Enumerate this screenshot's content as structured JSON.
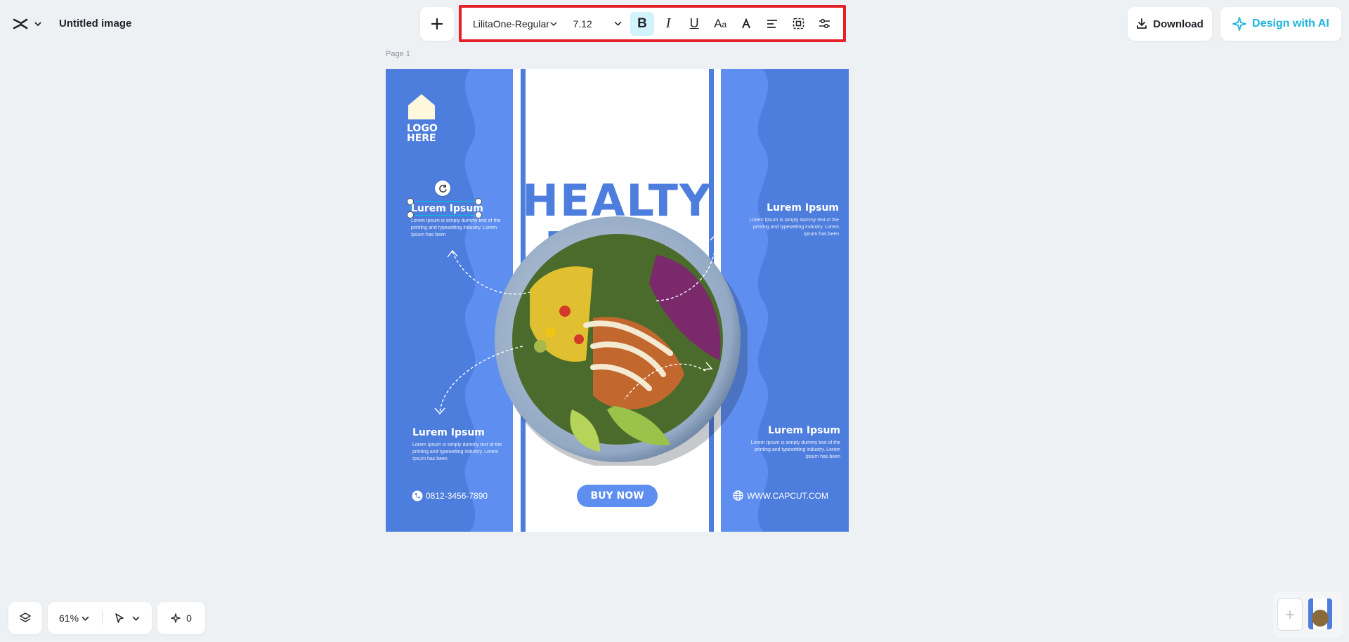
{
  "header": {
    "doc_title": "Untitled image",
    "download_label": "Download",
    "ai_label": "Design with AI"
  },
  "toolbar": {
    "font_name": "LilitaOne-Regular",
    "font_size": "7.12",
    "bold_active": true
  },
  "canvas": {
    "page_label": "Page 1"
  },
  "poster": {
    "logo_text_1": "LOGO",
    "logo_text_2": "HERE",
    "headline_1": "HEALTY",
    "headline_2": "FOOD",
    "top_left_title": "Lurem Ipsum",
    "top_left_body": "Lorem Ipsum is simply dummy text of the printing and typesetting industry. Lorem Ipsum has been",
    "top_right_title": "Lurem Ipsum",
    "top_right_body": "Lorem Ipsum is simply dummy text of the printing and typesetting industry. Lorem Ipsum has been",
    "bottom_left_title": "Lurem Ipsum",
    "bottom_left_body": "Lorem Ipsum is simply dummy text of the printing and typesetting industry. Lorem Ipsum has been",
    "bottom_right_title": "Lurem Ipsum",
    "bottom_right_body": "Lorem Ipsum is simply dummy text of the printing and typesetting industry. Lorem Ipsum has been",
    "buy_now": "BUY NOW",
    "phone": "0812-3456-7890",
    "website": "WWW.CAPCUT.COM"
  },
  "bottom_bar": {
    "zoom": "61%",
    "magic_count": "0"
  },
  "colors": {
    "accent": "#1fb4dc",
    "poster_blue": "#4d7ddd",
    "selection_red": "#e5202a"
  },
  "icons": [
    "capcut-logo-icon",
    "chevron-down-icon",
    "plus-icon",
    "bold-icon",
    "italic-icon",
    "underline-icon",
    "text-case-icon",
    "text-color-icon",
    "align-left-icon",
    "text-box-icon",
    "adjust-icon",
    "download-icon",
    "ai-sparkle-icon",
    "layers-icon",
    "pointer-icon",
    "sparkle-icon",
    "phone-icon",
    "globe-icon",
    "home-icon",
    "rotate-icon"
  ]
}
